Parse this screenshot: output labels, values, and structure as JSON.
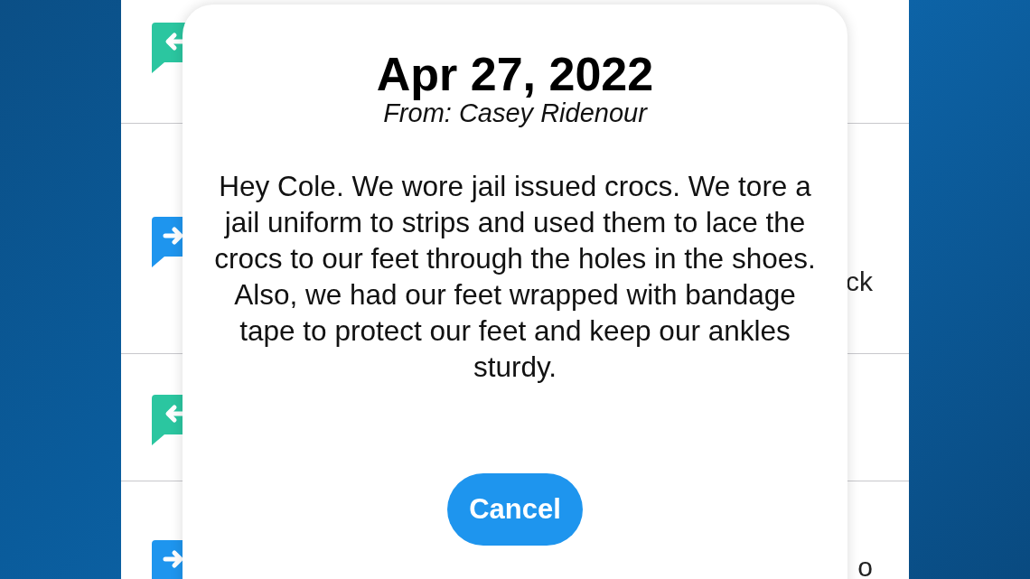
{
  "messages": [
    {
      "kind": "received"
    },
    {
      "kind": "sent",
      "tail": "ck"
    },
    {
      "kind": "received"
    },
    {
      "kind": "sent",
      "tail": "o"
    }
  ],
  "dialog": {
    "title": "Apr 27, 2022",
    "sender": "From: Casey Ridenour",
    "body": "Hey Cole. We wore jail issued crocs. We tore a jail uniform to strips and used them to lace the crocs to our feet through the holes in the shoes. Also, we had our feet wrapped with bandage tape to protect our feet and keep our ankles sturdy.",
    "button": "Cancel"
  }
}
